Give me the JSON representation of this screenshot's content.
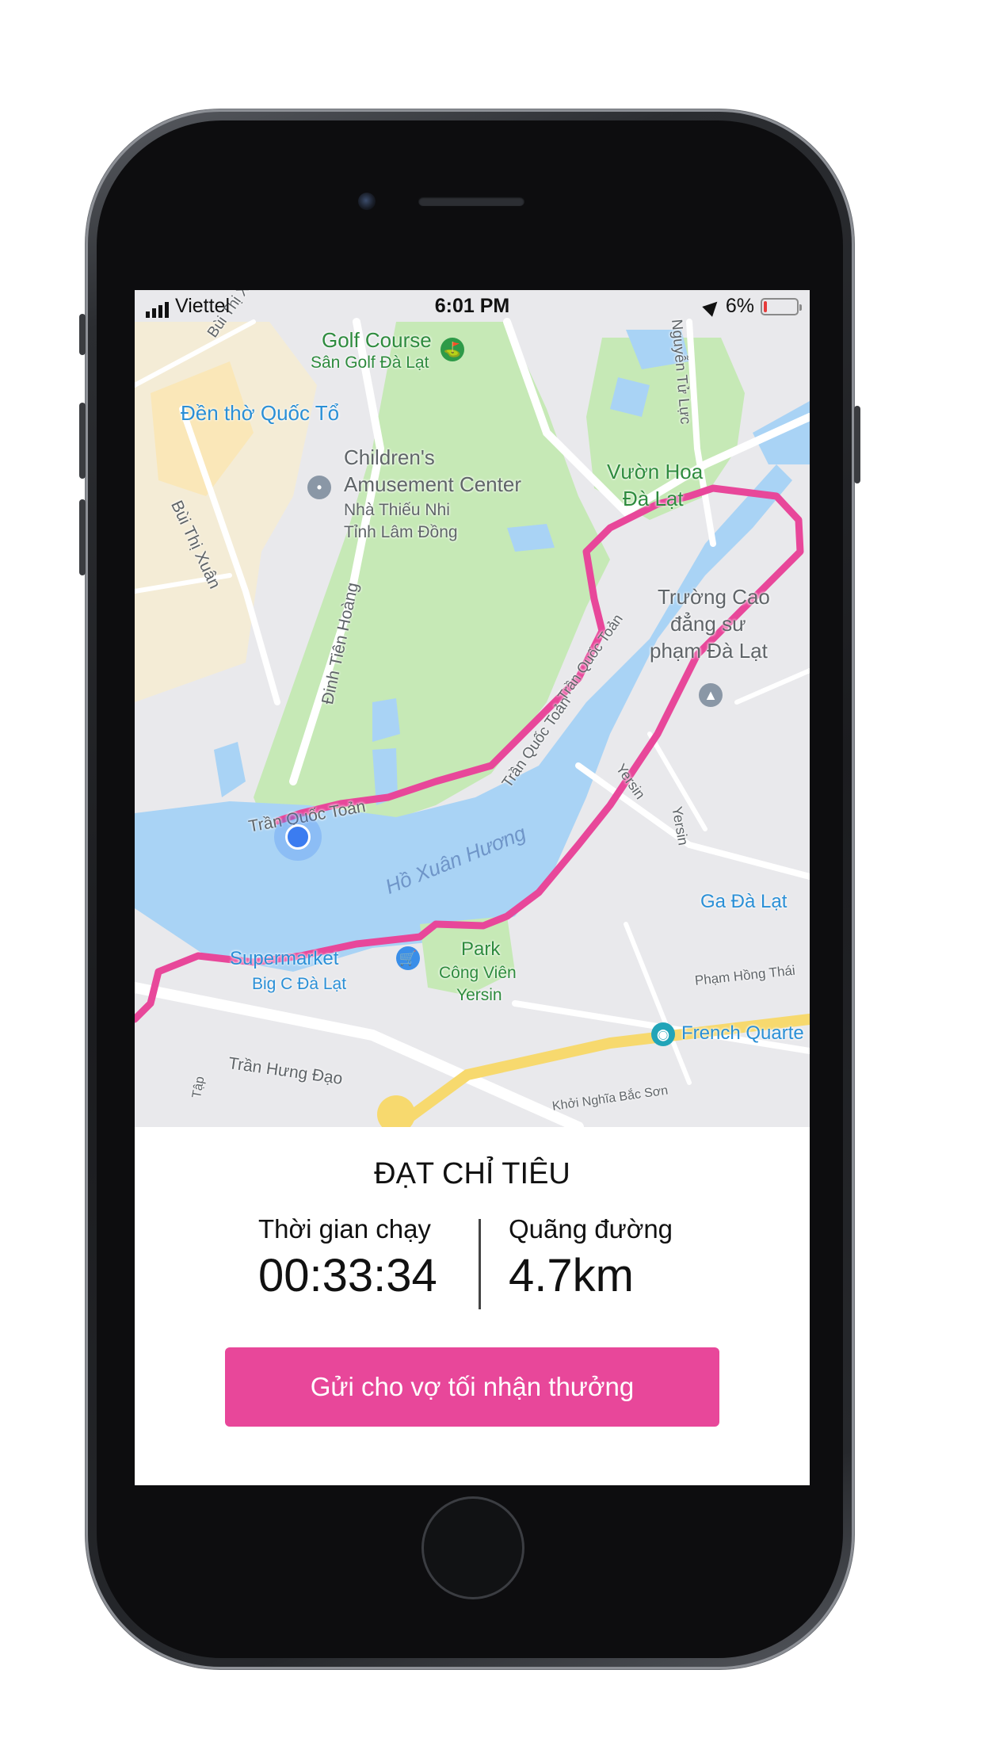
{
  "status_bar": {
    "carrier": "Viettel",
    "time": "6:01 PM",
    "battery_text": "6%",
    "battery_level": 0.06,
    "location_icon": "location-arrow-icon"
  },
  "map": {
    "labels": {
      "golf_course": "Golf Course",
      "san_golf": "Sân Golf Đà Lạt",
      "den_tho": "Đền thờ Quốc Tổ",
      "childrens": "Children's",
      "amusement": "Amusement Center",
      "nha_thieu_nhi": "Nhà Thiếu Nhi",
      "tinh_lam_dong": "Tỉnh Lâm Đồng",
      "vuon_hoa": "Vườn Hoa",
      "da_lat": "Đà Lạt",
      "truong_cao": "Trường Cao",
      "dang_su": "đẳng sư",
      "pham_da_lat": "phạm Đà Lạt",
      "bui_thi_xuan_top": "Bùi Thị Xuân",
      "bui_thi_xuan_left": "Bùi Thị Xuân",
      "dinh_tien_hoang": "Đinh Tiên Hoàng",
      "tran_quoc_toan_1": "Trần Quốc Toản",
      "tran_quoc_toan_2": "Trần Quốc Toản",
      "tran_quoc_toan_3": "Trần Quốc Toản",
      "ho_xuan_huong": "Hồ Xuân Hương",
      "yersin_1": "Yersin",
      "yersin_2": "Yersin",
      "nguyen_tu_luc": "Nguyễn Tử Lực",
      "ga_da_lat": "Ga Đà Lạt",
      "supermarket": "Supermarket",
      "big_c": "Big C Đà Lạt",
      "park": "Park",
      "cong_vien": "Công Viên",
      "yersin_park": "Yersin",
      "pham_hong_thai": "Phạm Hồng Thái",
      "french_quarter": "French Quarte",
      "tran_hung_dao": "Trần Hưng Đạo",
      "khoi_nghia": "Khởi Nghĩa Bắc Sơn",
      "tap": "Tập"
    },
    "route_color": "#e8479a",
    "lake_color": "#a9d3f5",
    "park_color": "#c6e9b6",
    "user_location_color": "#3b7cf0"
  },
  "results": {
    "title": "ĐẠT CHỈ TIÊU",
    "time_label": "Thời gian chạy",
    "time_value": "00:33:34",
    "distance_label": "Quãng đường",
    "distance_value": "4.7km",
    "cta_label": "Gửi cho vợ tối nhận thưởng",
    "accent_color": "#e8479a"
  }
}
